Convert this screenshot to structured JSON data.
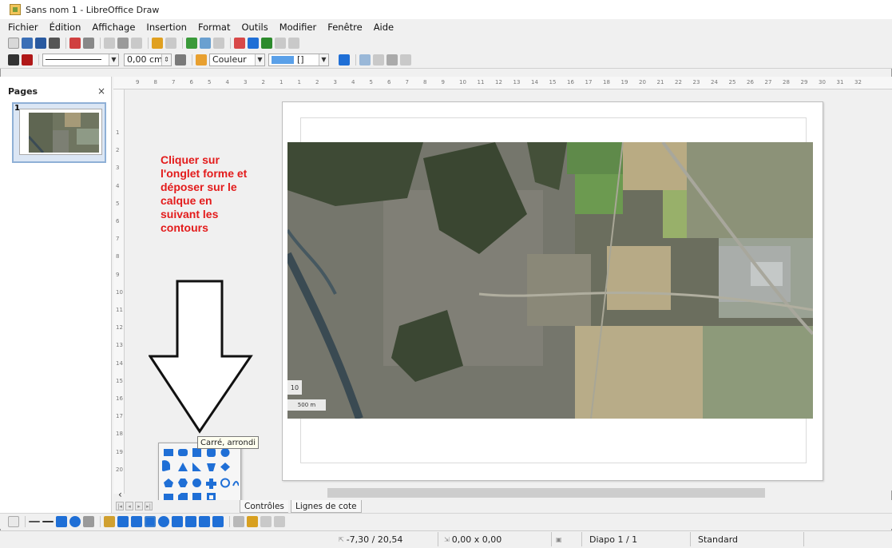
{
  "window": {
    "title": "Sans nom 1 - LibreOffice Draw"
  },
  "menu": {
    "items": [
      "Fichier",
      "Édition",
      "Affichage",
      "Insertion",
      "Format",
      "Outils",
      "Modifier",
      "Fenêtre",
      "Aide"
    ]
  },
  "toolbar2": {
    "line_width": "0,00 cm",
    "area_style": "Couleur",
    "area_value": "[]"
  },
  "pages_panel": {
    "title": "Pages",
    "close": "×",
    "page_number": "1"
  },
  "ruler": {
    "h_ticks": [
      "9",
      "8",
      "7",
      "6",
      "5",
      "4",
      "3",
      "2",
      "1",
      "1",
      "2",
      "3",
      "4",
      "5",
      "6",
      "7",
      "8",
      "9",
      "10",
      "11",
      "12",
      "13",
      "14",
      "15",
      "16",
      "17",
      "18",
      "19",
      "20",
      "21",
      "22",
      "23",
      "24",
      "25",
      "26",
      "27",
      "28",
      "29",
      "30",
      "31",
      "32"
    ],
    "v_ticks": [
      "1",
      "2",
      "3",
      "4",
      "5",
      "6",
      "7",
      "8",
      "9",
      "10",
      "11",
      "12",
      "13",
      "14",
      "15",
      "16",
      "17",
      "18",
      "19",
      "20"
    ]
  },
  "instruction": "Cliquer sur\nl'onglet forme et\ndéposer sur le\ncalque en\nsuivant les\ncontours",
  "map_overlay": {
    "scale_top": "10",
    "scale_bottom": "500 m"
  },
  "tooltip": "Carré, arrondi",
  "layer_tabs": {
    "controls": "Contrôles",
    "dimension_lines": "Lignes de cote"
  },
  "status": {
    "position": "-7,30 / 20,54",
    "size": "0,00 x 0,00",
    "slide": "Diapo 1 / 1",
    "layout": "Standard"
  },
  "colors": {
    "instruction_red": "#e31b1b",
    "shape_blue": "#1f6fd6",
    "area_fill": "#5aa0e8"
  }
}
